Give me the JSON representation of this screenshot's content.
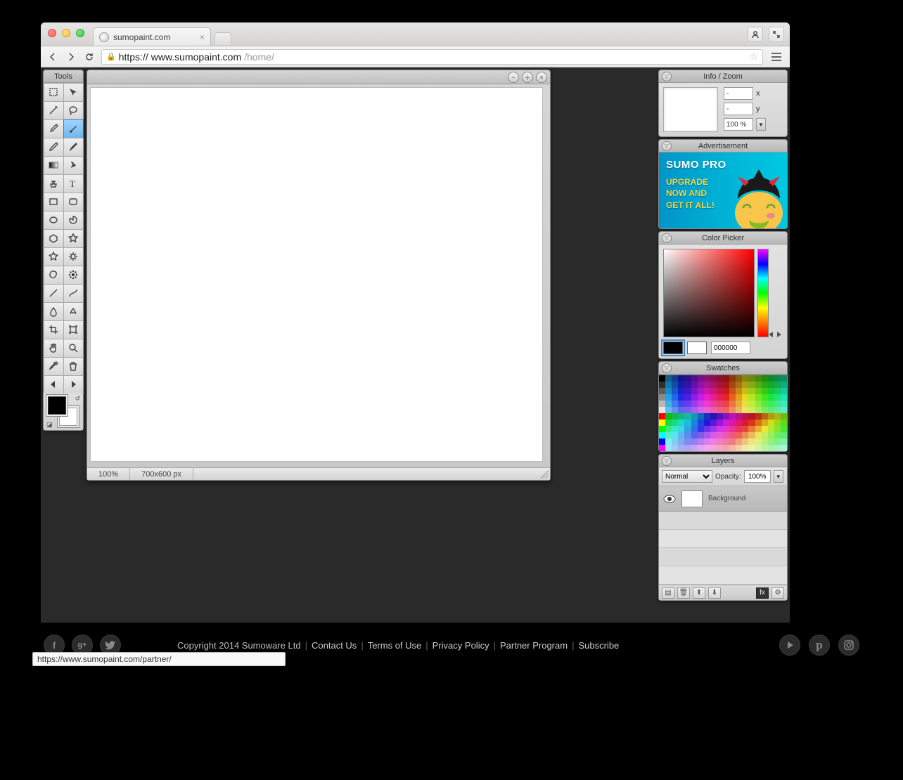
{
  "browser": {
    "tab_title": "sumopaint.com",
    "url_scheme": "https://",
    "url_host": "www.sumopaint.com",
    "url_path": "/home/"
  },
  "tools_panel": {
    "title": "Tools",
    "tools": [
      "rect-select",
      "move",
      "magic-wand",
      "lasso",
      "eyedropper",
      "brush",
      "pencil",
      "ink",
      "gradient",
      "smudge",
      "clone-stamp",
      "text",
      "rectangle",
      "rounded-rect",
      "ellipse",
      "pie",
      "polygon",
      "star",
      "star-rounded",
      "gear",
      "blob",
      "symmetry",
      "line",
      "curve",
      "blur",
      "sharpen",
      "crop",
      "transform",
      "hand",
      "zoom",
      "color-picker",
      "trash",
      "arrow-left",
      "arrow-right"
    ],
    "selected_index": 5,
    "fg_color": "#000000",
    "bg_color": "#ffffff"
  },
  "canvas": {
    "zoom": "100%",
    "dimensions": "700x600 px"
  },
  "info_zoom": {
    "title": "Info / Zoom",
    "x": "-",
    "y": "-",
    "x_label": "x",
    "y_label": "y",
    "zoom": "100 %"
  },
  "advertisement": {
    "title": "Advertisement",
    "headline": "SUMO PRO",
    "line1": "UPGRADE",
    "line2": "NOW AND",
    "line3": "GET IT ALL!"
  },
  "color_picker": {
    "title": "Color Picker",
    "hex": "000000",
    "fg": "#000000",
    "bg": "#ffffff"
  },
  "swatches": {
    "title": "Swatches"
  },
  "layers": {
    "title": "Layers",
    "blend_mode": "Normal",
    "opacity_label": "Opacity:",
    "opacity": "100%",
    "items": [
      {
        "name": "Background"
      }
    ]
  },
  "footer": {
    "copyright": "Copyright 2014 Sumoware Ltd",
    "links": [
      "Contact Us",
      "Terms of Use",
      "Privacy Policy",
      "Partner Program",
      "Subscribe"
    ]
  },
  "status_link": "https://www.sumopaint.com/partner/"
}
